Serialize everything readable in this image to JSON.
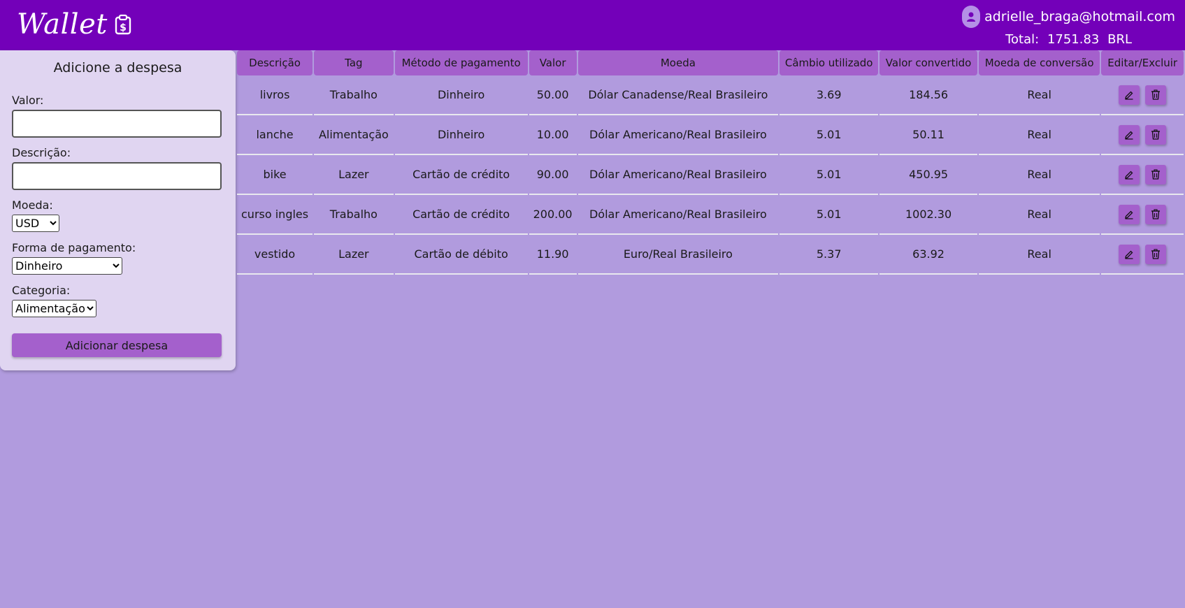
{
  "header": {
    "title": "Wallet",
    "logo_icon": "clipboard-dollar-icon",
    "user_email": "adrielle_braga@hotmail.com",
    "total_label": "Total:",
    "total_value": "1751.83",
    "currency": "BRL"
  },
  "form": {
    "title": "Adicione a despesa",
    "valor_label": "Valor:",
    "valor_value": "",
    "descricao_label": "Descrição:",
    "descricao_value": "",
    "moeda_label": "Moeda:",
    "moeda_selected": "USD",
    "pagamento_label": "Forma de pagamento:",
    "pagamento_selected": "Dinheiro",
    "categoria_label": "Categoria:",
    "categoria_selected": "Alimentação",
    "submit_label": "Adicionar despesa"
  },
  "table": {
    "headers": [
      "Descrição",
      "Tag",
      "Método de pagamento",
      "Valor",
      "Moeda",
      "Câmbio utilizado",
      "Valor convertido",
      "Moeda de conversão",
      "Editar/Excluir"
    ],
    "rows": [
      {
        "descricao": "livros",
        "tag": "Trabalho",
        "metodo": "Dinheiro",
        "valor": "50.00",
        "moeda": "Dólar Canadense/Real Brasileiro",
        "cambio": "3.69",
        "convertido": "184.56",
        "conversao": "Real"
      },
      {
        "descricao": "lanche",
        "tag": "Alimentação",
        "metodo": "Dinheiro",
        "valor": "10.00",
        "moeda": "Dólar Americano/Real Brasileiro",
        "cambio": "5.01",
        "convertido": "50.11",
        "conversao": "Real"
      },
      {
        "descricao": "bike",
        "tag": "Lazer",
        "metodo": "Cartão de crédito",
        "valor": "90.00",
        "moeda": "Dólar Americano/Real Brasileiro",
        "cambio": "5.01",
        "convertido": "450.95",
        "conversao": "Real"
      },
      {
        "descricao": "curso ingles",
        "tag": "Trabalho",
        "metodo": "Cartão de crédito",
        "valor": "200.00",
        "moeda": "Dólar Americano/Real Brasileiro",
        "cambio": "5.01",
        "convertido": "1002.30",
        "conversao": "Real"
      },
      {
        "descricao": "vestido",
        "tag": "Lazer",
        "metodo": "Cartão de débito",
        "valor": "11.90",
        "moeda": "Euro/Real Brasileiro",
        "cambio": "5.37",
        "convertido": "63.92",
        "conversao": "Real"
      }
    ],
    "edit_icon": "pencil-icon",
    "delete_icon": "trash-icon"
  },
  "colors": {
    "header_bg": "#7300b9",
    "page_bg": "#b19bde",
    "panel_bg": "#e0d5f1",
    "accent": "#a460cc"
  }
}
